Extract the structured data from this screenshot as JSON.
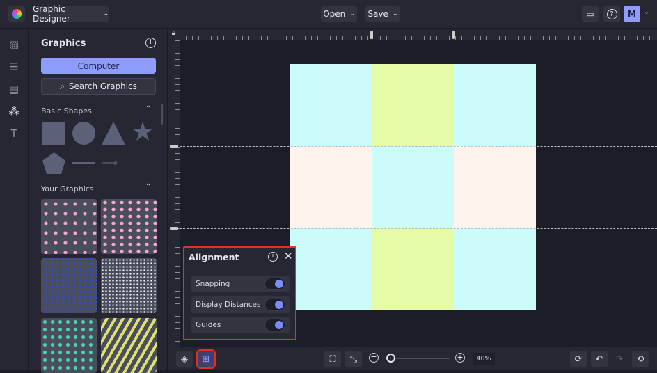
{
  "header": {
    "project_name": "Graphic Designer",
    "open_label": "Open",
    "save_label": "Save",
    "avatar_initial": "M"
  },
  "panel": {
    "title": "Graphics",
    "computer_button": "Computer",
    "search_button": "Search Graphics",
    "basic_shapes_label": "Basic Shapes",
    "your_graphics_label": "Your Graphics"
  },
  "alignment": {
    "title": "Alignment",
    "options": [
      {
        "label": "Snapping",
        "enabled": true
      },
      {
        "label": "Display Distances",
        "enabled": true
      },
      {
        "label": "Guides",
        "enabled": true
      }
    ]
  },
  "zoom": {
    "value": "40%",
    "level_percent": 40
  },
  "colors": {
    "accent": "#7b8cff",
    "cyan": "#ccfcf9",
    "lime": "#e6fba6",
    "peach": "#fff3ee",
    "highlight": "#e0321e"
  }
}
